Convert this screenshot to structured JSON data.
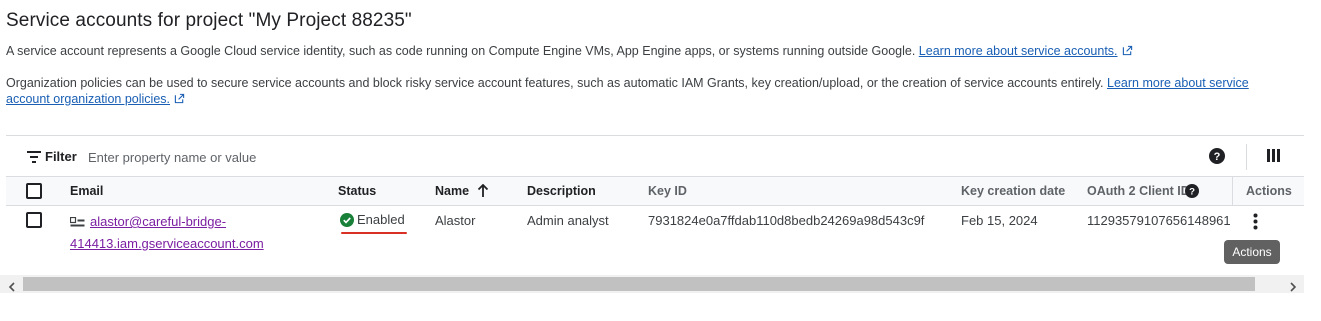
{
  "page": {
    "title": "Service accounts for project \"My Project 88235\"",
    "intro": {
      "text": "A service account represents a Google Cloud service identity, such as code running on Compute Engine VMs, App Engine apps, or systems running outside Google. ",
      "link": "Learn more about service accounts."
    },
    "policy": {
      "text": "Organization policies can be used to secure service accounts and block risky service account features, such as automatic IAM Grants, key creation/upload, or the creation of service accounts entirely. ",
      "link": "Learn more about service account organization policies."
    }
  },
  "filter": {
    "label": "Filter",
    "placeholder": "Enter property name or value"
  },
  "table": {
    "columns": {
      "email": "Email",
      "status": "Status",
      "name": "Name",
      "description": "Description",
      "key_id": "Key ID",
      "key_creation_date": "Key creation date",
      "oauth_client_id": "OAuth 2 Client ID",
      "actions": "Actions"
    },
    "rows": [
      {
        "email": "alastor@careful-bridge-414413.iam.gserviceaccount.com",
        "status": "Enabled",
        "name": "Alastor",
        "description": "Admin analyst",
        "key_id": "7931824e0a7ffdab110d8bedb24269a98d543c9f",
        "key_creation_date": "Feb 15, 2024",
        "oauth_client_id": "11293579107656148961"
      }
    ]
  },
  "tooltip": "Actions",
  "colors": {
    "link": "#1a5fb4",
    "visited_link": "#7b1fa2",
    "status_green": "#188038",
    "highlight_red": "#d93025"
  }
}
